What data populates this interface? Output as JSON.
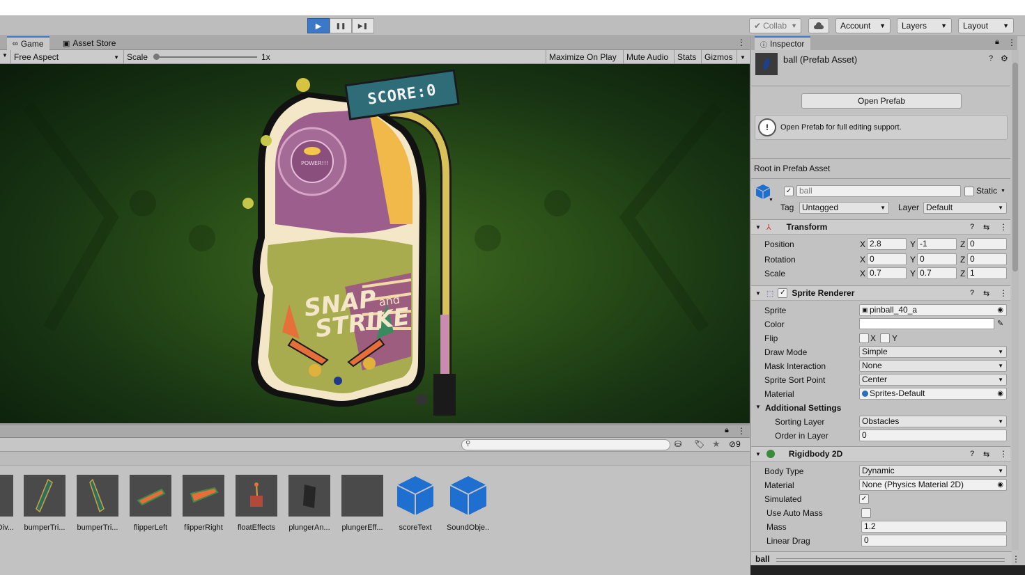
{
  "toolbar": {
    "play_label": "▶",
    "pause_label": "❚❚",
    "step_label": "▶❚",
    "collab_label": "Collab",
    "account_label": "Account",
    "layers_label": "Layers",
    "layout_label": "Layout"
  },
  "tabs": {
    "game": "Game",
    "asset_store": "Asset Store",
    "inspector": "Inspector"
  },
  "game_toolbar": {
    "aspect": "Free Aspect",
    "scale_label": "Scale",
    "scale_value": "1x",
    "maximize": "Maximize On Play",
    "mute": "Mute Audio",
    "stats": "Stats",
    "gizmos": "Gizmos"
  },
  "game_view": {
    "score_text": "SCORE:0",
    "title_line1": "SNAP",
    "title_and": "and",
    "title_line2": "STRIKE",
    "power_text": "POWER!!!"
  },
  "project": {
    "search_placeholder": "",
    "hidden_count": "9",
    "assets": [
      {
        "label": "Div...",
        "icon": "sprite-icon"
      },
      {
        "label": "bumperTri...",
        "icon": "sprite-icon"
      },
      {
        "label": "bumperTri...",
        "icon": "sprite-icon"
      },
      {
        "label": "flipperLeft",
        "icon": "sprite-icon"
      },
      {
        "label": "flipperRight",
        "icon": "sprite-icon"
      },
      {
        "label": "floatEffects",
        "icon": "sprite-icon"
      },
      {
        "label": "plungerAn...",
        "icon": "sprite-icon"
      },
      {
        "label": "plungerEff...",
        "icon": "sprite-icon"
      },
      {
        "label": "scoreText",
        "icon": "prefab-cube-icon"
      },
      {
        "label": "SoundObje...",
        "icon": "prefab-cube-icon"
      }
    ]
  },
  "inspector": {
    "asset_name": "ball (Prefab Asset)",
    "open_prefab": "Open Prefab",
    "info_text": "Open Prefab for full editing support.",
    "root_label": "Root in Prefab Asset",
    "object_name": "ball",
    "static_label": "Static",
    "tag_label": "Tag",
    "tag_value": "Untagged",
    "layer_label": "Layer",
    "layer_value": "Default",
    "transform": {
      "title": "Transform",
      "position_label": "Position",
      "pos_x": "2.8",
      "pos_y": "-1",
      "pos_z": "0",
      "rotation_label": "Rotation",
      "rot_x": "0",
      "rot_y": "0",
      "rot_z": "0",
      "scale_label": "Scale",
      "scl_x": "0.7",
      "scl_y": "0.7",
      "scl_z": "1"
    },
    "sprite_renderer": {
      "title": "Sprite Renderer",
      "sprite_label": "Sprite",
      "sprite_value": "pinball_40_a",
      "color_label": "Color",
      "color_value": "#ffffff",
      "flip_label": "Flip",
      "flip_x": "X",
      "flip_y": "Y",
      "draw_mode_label": "Draw Mode",
      "draw_mode": "Simple",
      "mask_label": "Mask Interaction",
      "mask_value": "None",
      "sort_point_label": "Sprite Sort Point",
      "sort_point": "Center",
      "material_label": "Material",
      "material_value": "Sprites-Default",
      "additional": "Additional Settings",
      "sorting_layer_label": "Sorting Layer",
      "sorting_layer": "Obstacles",
      "order_label": "Order in Layer",
      "order_value": "0"
    },
    "rigidbody": {
      "title": "Rigidbody 2D",
      "body_type_label": "Body Type",
      "body_type": "Dynamic",
      "material_label": "Material",
      "material_value": "None (Physics Material 2D)",
      "simulated_label": "Simulated",
      "auto_mass_label": "Use Auto Mass",
      "mass_label": "Mass",
      "mass_value": "1.2",
      "linear_drag_label": "Linear Drag",
      "linear_drag_value": "0"
    },
    "footer_name": "ball",
    "check_mark": "✓",
    "axis_x": "X",
    "axis_y": "Y",
    "axis_z": "Z"
  },
  "colors": {
    "accent": "#3b78c7",
    "game_bg": "#2a4f18",
    "prefab_blue": "#1f6fd1"
  }
}
